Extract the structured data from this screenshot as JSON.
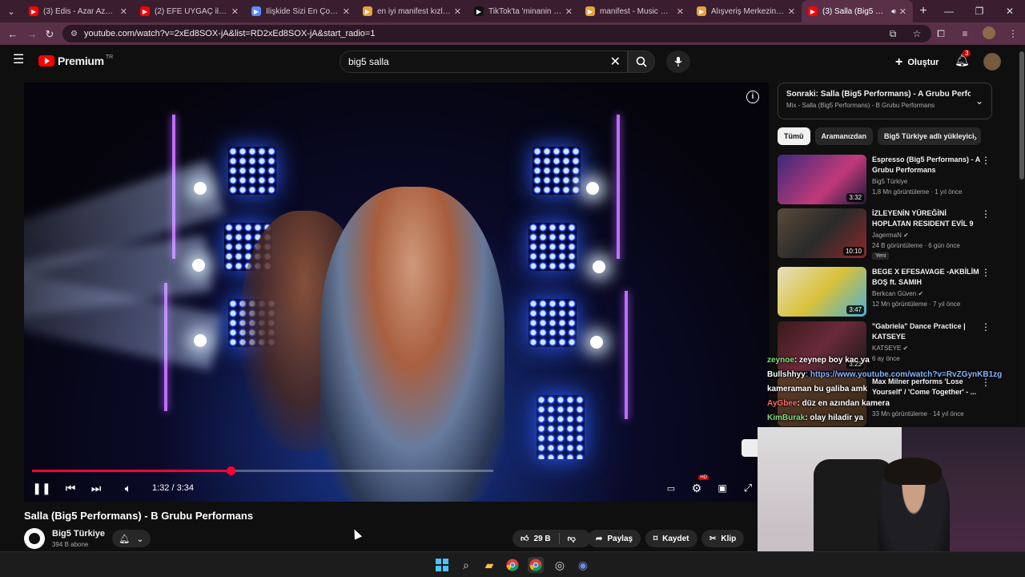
{
  "browser": {
    "tabs": [
      {
        "title": "(3) Edis - Azar Azar (Offici",
        "icon": "youtube-icon",
        "color": "#ff0000"
      },
      {
        "title": "(2) EFE UYGAÇ ile SINIRSIZ",
        "icon": "youtube-icon",
        "color": "#ff0000"
      },
      {
        "title": "İlişkide Sizi En Çok Rahatsız",
        "icon": "document-icon",
        "color": "#5b8cff"
      },
      {
        "title": "en iyi manifest kızları tiktok",
        "icon": "folder-icon",
        "color": "#e6a23c"
      },
      {
        "title": "TikTok'ta 'minanin sevgilisi'",
        "icon": "tiktok-icon",
        "color": "#111111"
      },
      {
        "title": "manifest - Music Quiz - Qu",
        "icon": "folder-icon",
        "color": "#e6a23c"
      },
      {
        "title": "Alışveriş Merkezinde Hangi",
        "icon": "folder-icon",
        "color": "#e6a23c"
      },
      {
        "title": "(3) Salla (Big5 Perform",
        "icon": "youtube-icon",
        "color": "#ff0000",
        "active": true
      }
    ],
    "new_tab": "+",
    "url": "youtube.com/watch?v=2xEd8SOX-jA&list=RD2xEd8SOX-jA&start_radio=1"
  },
  "youtube": {
    "logo_text": "Premium",
    "country_code": "TR",
    "search_query": "big5 salla",
    "create_label": "Oluştur",
    "notification_count": "3"
  },
  "player": {
    "time": "1:32 / 3:34",
    "progress_fraction": 0.43,
    "buffered_fraction": 0.62
  },
  "video": {
    "title": "Salla (Big5 Performans) - B Grubu Performans",
    "channel": "Big5 Türkiye",
    "subscribers": "394 B abone",
    "likes": "29 B",
    "share_label": "Paylaş",
    "save_label": "Kaydet",
    "clip_label": "Klip"
  },
  "sidebar": {
    "next_up_title": "Sonraki: Salla (Big5 Performans) - A Grubu Performans",
    "next_up_sub": "Mix - Salla (Big5 Performans) - B Grubu Performans",
    "chips": [
      "Tümü",
      "Aramanızdan",
      "Big5 Türkiye adlı yükleyici"
    ],
    "recommendations": [
      {
        "title": "Espresso (Big5 Performans) - A Grubu Performans",
        "channel": "Big5 Türkiye",
        "meta": "1,8 Mn görüntüleme · 1 yıl önce",
        "duration": "3:32",
        "verified": false,
        "new": ""
      },
      {
        "title": "İZLEYENİN YÜREĞİNİ HOPLATAN RESIDENT EVİL 9 ...",
        "channel": "JagermaN",
        "meta": "24 B görüntüleme · 6 gün önce",
        "duration": "10:10",
        "verified": true,
        "new": "Yeni"
      },
      {
        "title": "BEGE X EFESAVAGE -AKBİLİM BOŞ ft. SAMIH",
        "channel": "Berkcan Güven",
        "meta": "12 Mn görüntüleme · 7 yıl önce",
        "duration": "3:47",
        "verified": true,
        "new": ""
      },
      {
        "title": "\"Gabriela\" Dance Practice | KATSEYE",
        "channel": "KATSEYE",
        "meta": "6 ay önce",
        "duration": "3:23",
        "verified": true,
        "new": ""
      },
      {
        "title": "Max Milner performs 'Lose Yourself' / 'Come Together' - ...",
        "channel": "",
        "meta": "33 Mn görüntüleme · 14 yıl önce",
        "duration": "",
        "verified": false,
        "new": ""
      }
    ]
  },
  "chat": [
    {
      "user": "zeynoe",
      "text": ": zeynep boy kac ya",
      "color": "#7ee07e"
    },
    {
      "user": "Bullshhyy",
      "text": ": https://www.youtube.com/watch?v=RvZGynKB1zg",
      "color": "#ffffff",
      "link": true
    },
    {
      "user": "",
      "text": "kameraman bu galiba amk",
      "color": "#ffffff"
    },
    {
      "user": "AyGbee",
      "text": ": düz en azından kamera",
      "color": "#ff6b6b"
    },
    {
      "user": "KimBurak",
      "text": ": olay hiladir ya",
      "color": "#7ee07e"
    }
  ],
  "colors": {
    "accent": "#ff0033",
    "tab_bg": "#3a1e2f",
    "toolbar_bg": "#5a2f48"
  }
}
